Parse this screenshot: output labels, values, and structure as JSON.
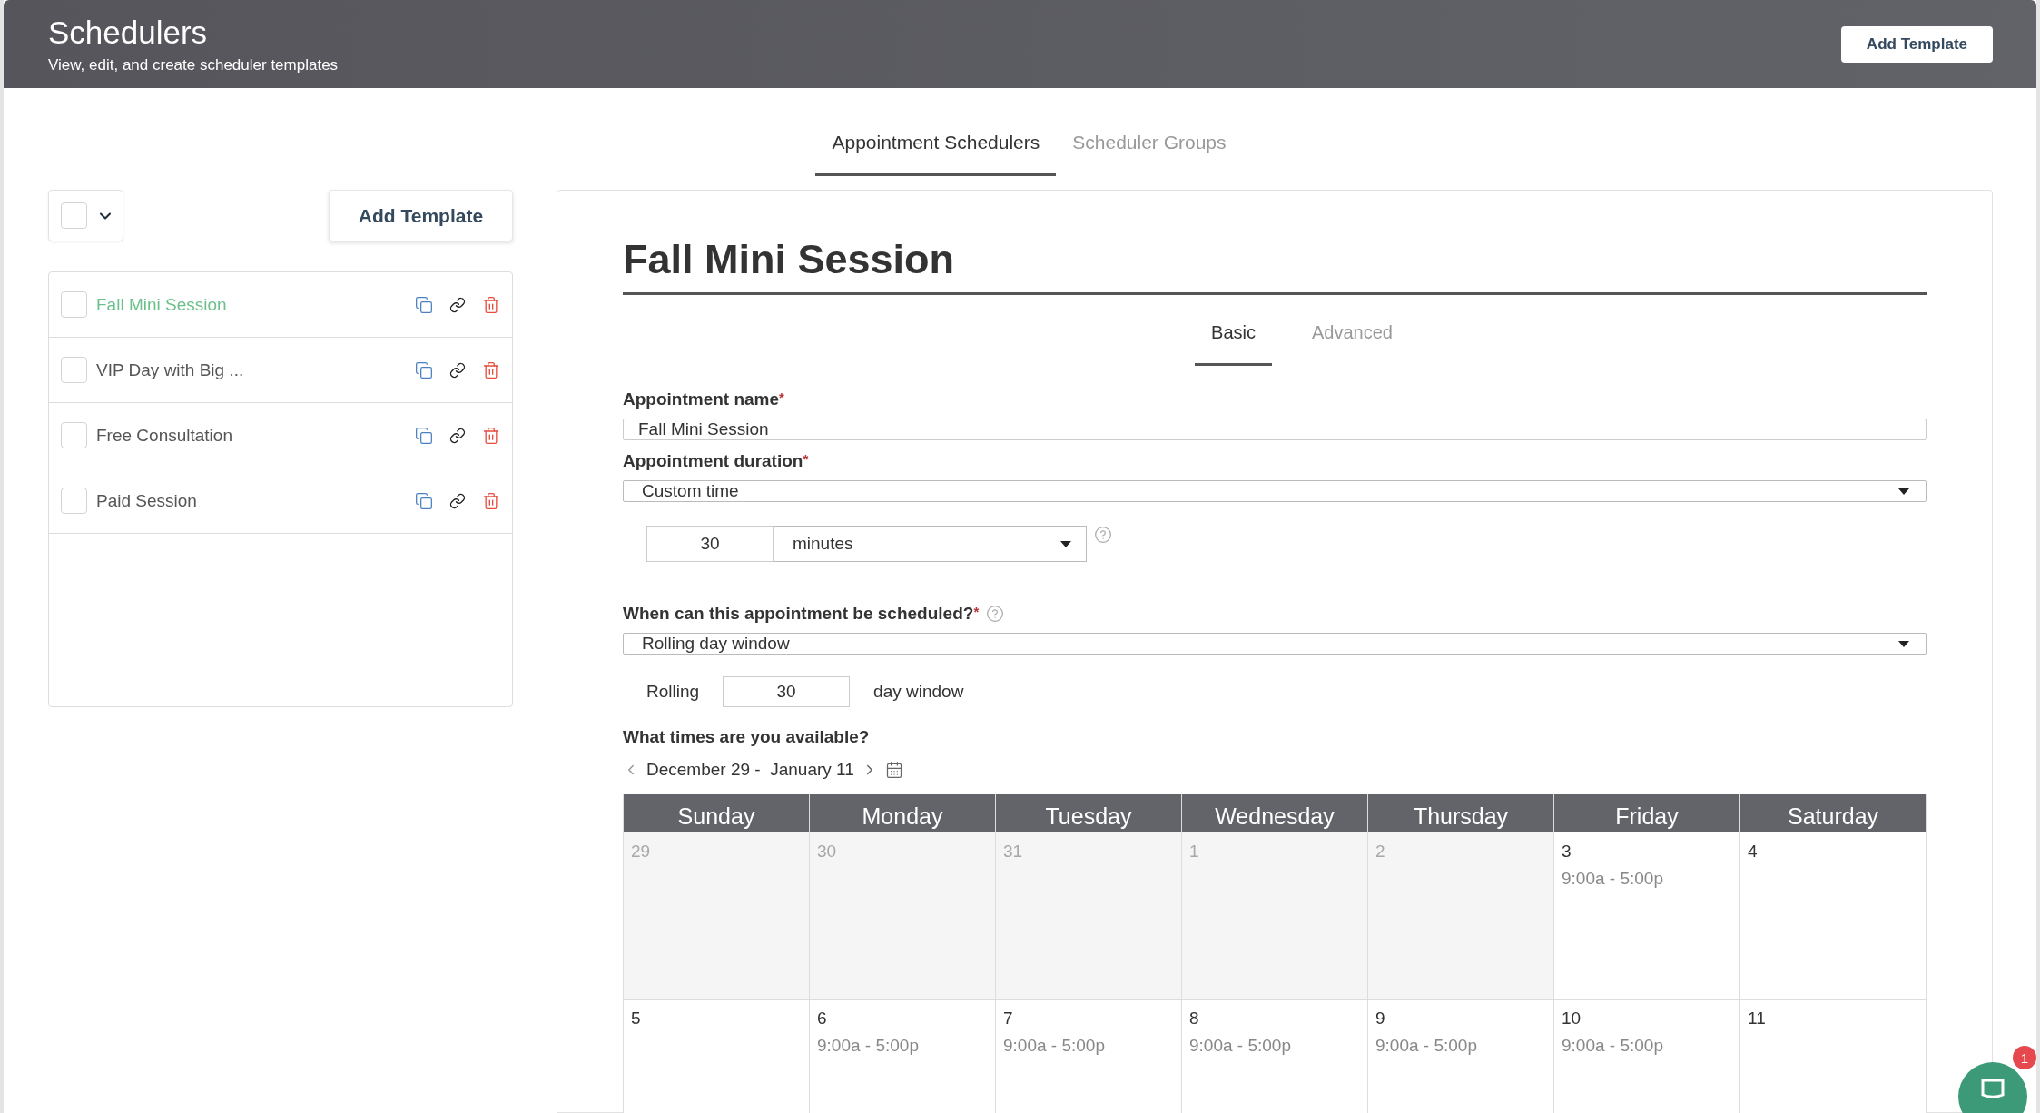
{
  "header": {
    "title": "Schedulers",
    "subtitle": "View, edit, and create scheduler templates",
    "button": "Add Template"
  },
  "tabs": [
    {
      "label": "Appointment Schedulers",
      "selected": true
    },
    {
      "label": "Scheduler Groups",
      "selected": false
    }
  ],
  "sidebar": {
    "select_all": {
      "checked": false
    },
    "add_button": "Add Template",
    "items": [
      {
        "name": "Fall Mini Session",
        "selected": true,
        "checked": false
      },
      {
        "name": "VIP Day with Big ...",
        "selected": false,
        "checked": false
      },
      {
        "name": "Free Consultation",
        "selected": false,
        "checked": false
      },
      {
        "name": "Paid Session",
        "selected": false,
        "checked": false
      }
    ]
  },
  "editor": {
    "title": "Fall Mini Session",
    "tabs": [
      {
        "label": "Basic",
        "selected": true
      },
      {
        "label": "Advanced",
        "selected": false
      }
    ],
    "name_label": "Appointment name",
    "name_mark": "*",
    "name_value": "Fall Mini Session",
    "duration_label": "Appointment duration",
    "duration_mark": "*",
    "duration_value": "Custom time",
    "duration_amount": "30",
    "duration_unit": "minutes",
    "when_label": "When can this appointment be scheduled?",
    "when_mark": "*",
    "when_value": "Rolling day window",
    "rolling_label": "Rolling",
    "rolling_value": "30",
    "rolling_suffix": "day window",
    "availability_label": "What times are you available?",
    "date_range": "December 29 -  January 11",
    "calendar": {
      "weekdays": [
        "Sunday",
        "Monday",
        "Tuesday",
        "Wednesday",
        "Thursday",
        "Friday",
        "Saturday"
      ],
      "weeks": [
        [
          {
            "date": "29",
            "outside": true
          },
          {
            "date": "30",
            "outside": true
          },
          {
            "date": "31",
            "outside": true
          },
          {
            "date": "1",
            "outside": true
          },
          {
            "date": "2",
            "outside": true
          },
          {
            "date": "3",
            "outside": false,
            "hours": "9:00a - 5:00p"
          },
          {
            "date": "4",
            "outside": false
          }
        ],
        [
          {
            "date": "5",
            "outside": false
          },
          {
            "date": "6",
            "outside": false,
            "hours": "9:00a - 5:00p"
          },
          {
            "date": "7",
            "outside": false,
            "hours": "9:00a - 5:00p"
          },
          {
            "date": "8",
            "outside": false,
            "hours": "9:00a - 5:00p"
          },
          {
            "date": "9",
            "outside": false,
            "hours": "9:00a - 5:00p"
          },
          {
            "date": "10",
            "outside": false,
            "hours": "9:00a - 5:00p"
          },
          {
            "date": "11",
            "outside": false
          }
        ]
      ]
    }
  },
  "chat": {
    "badge": "1"
  }
}
